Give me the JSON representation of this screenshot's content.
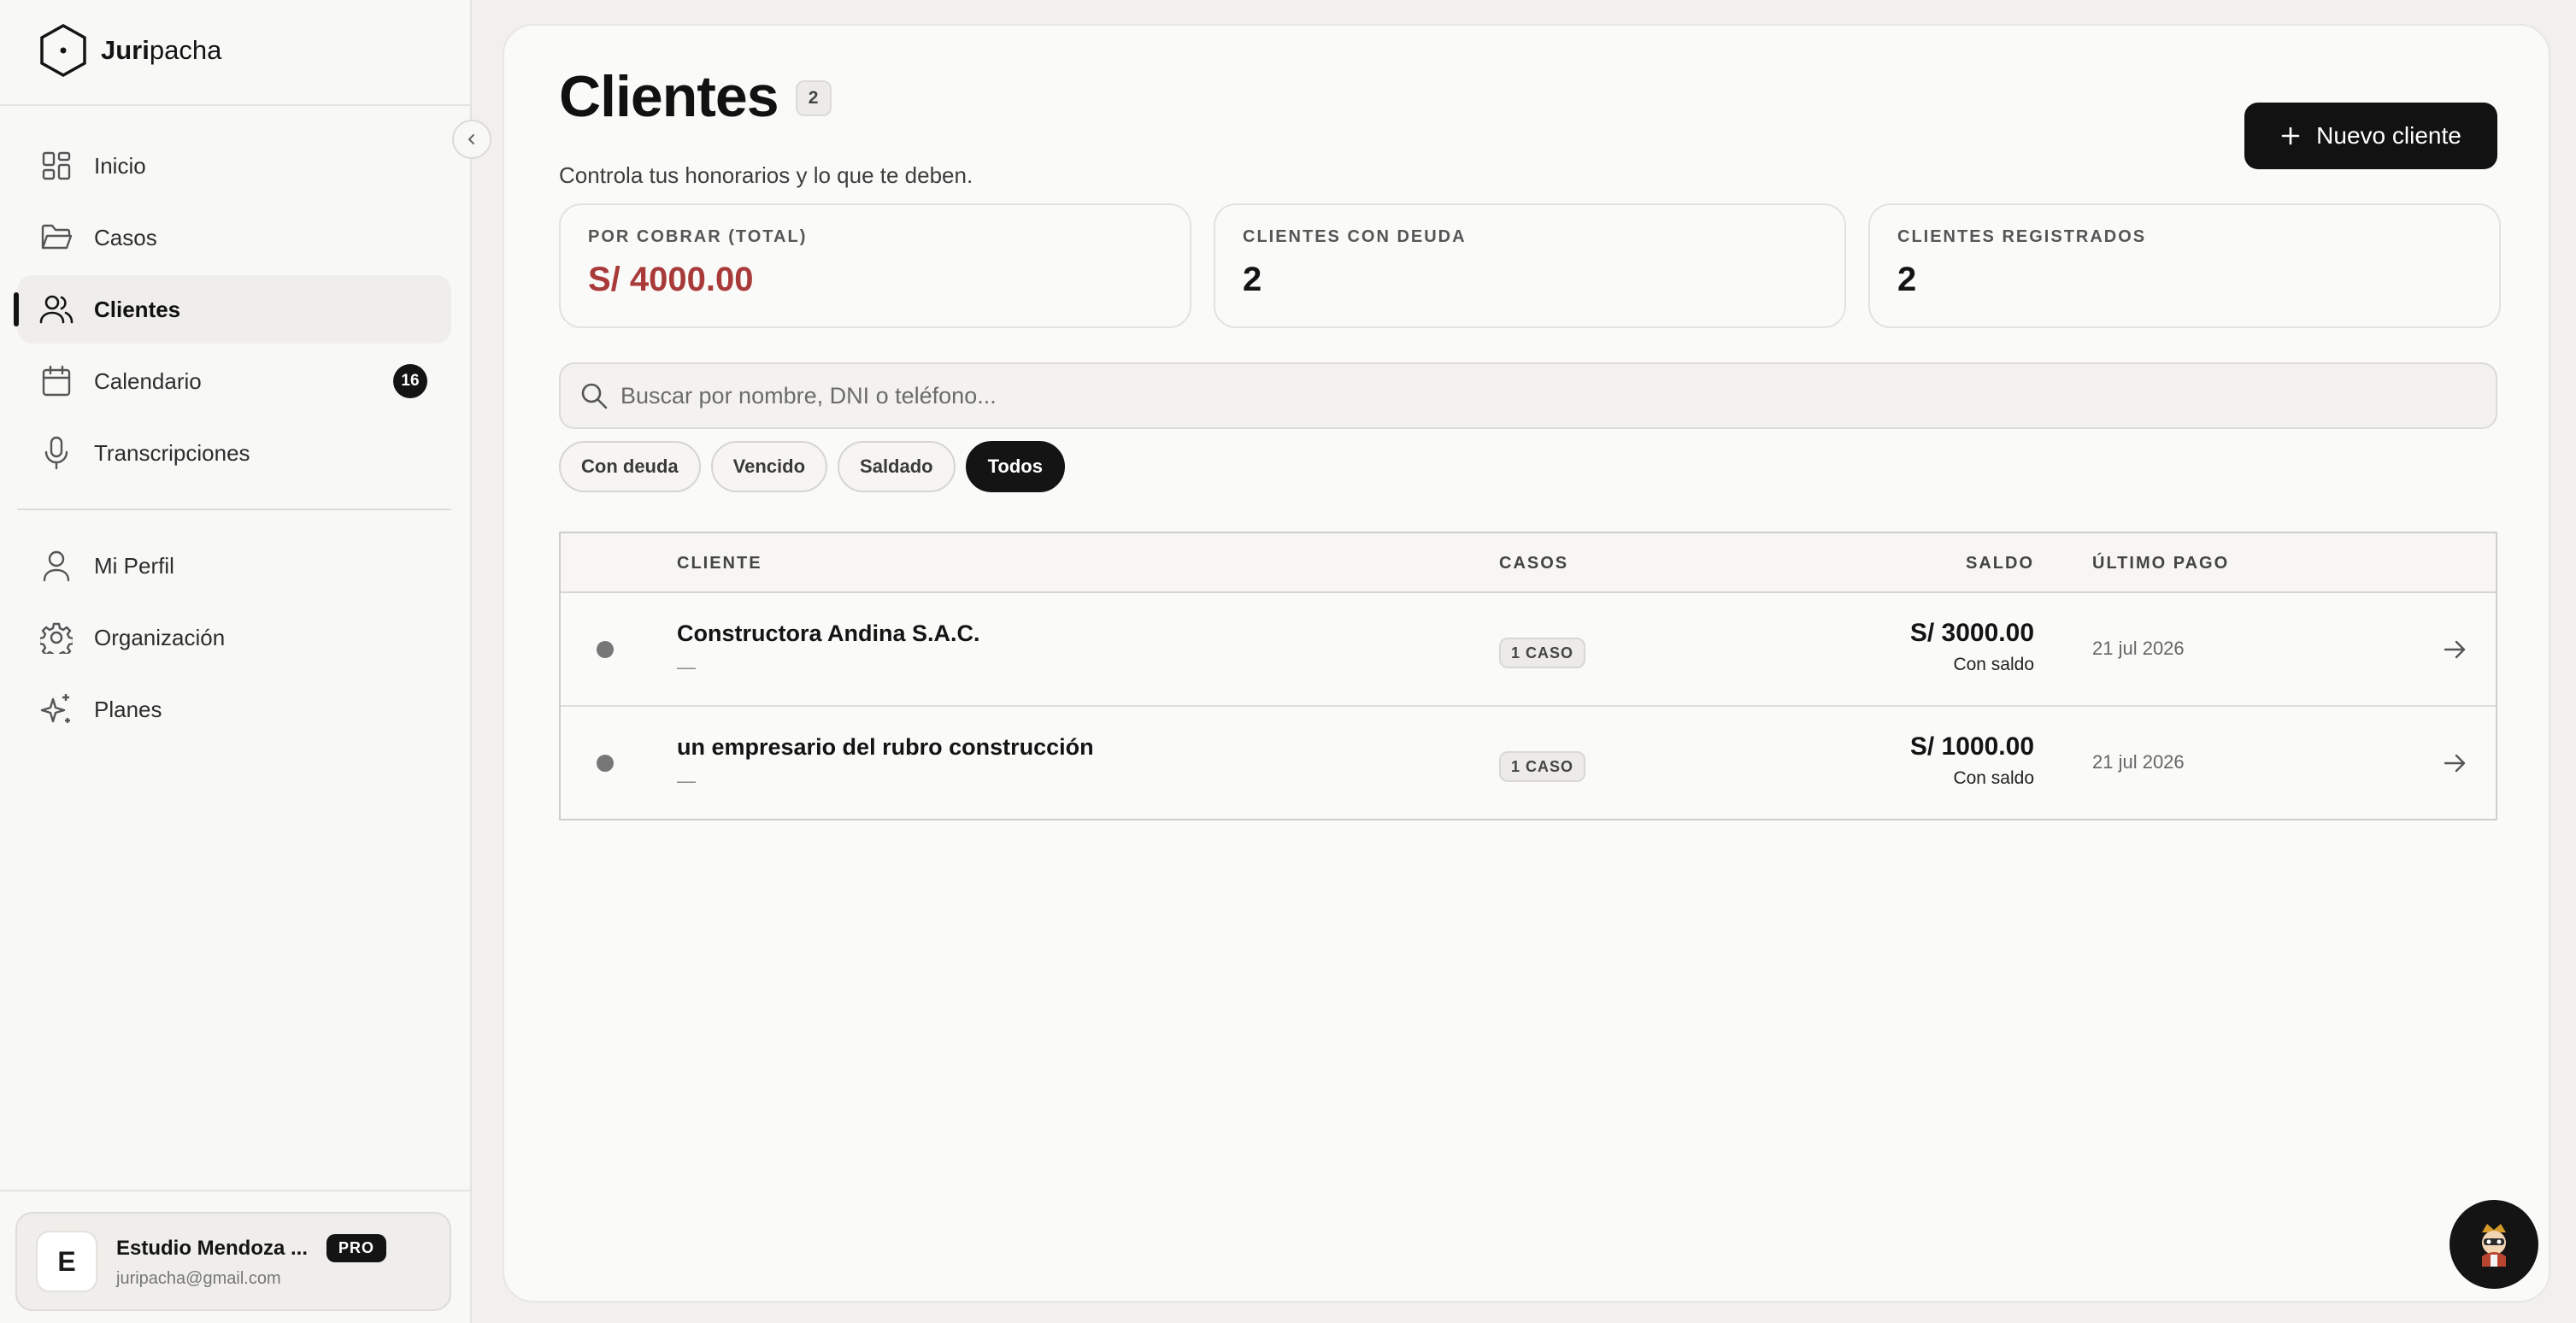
{
  "brand": {
    "bold": "Juri",
    "rest": "pacha"
  },
  "sidebar": {
    "items": [
      {
        "label": "Inicio",
        "icon": "dashboard-icon"
      },
      {
        "label": "Casos",
        "icon": "folder-icon"
      },
      {
        "label": "Clientes",
        "icon": "users-icon",
        "active": true
      },
      {
        "label": "Calendario",
        "icon": "calendar-icon",
        "badge": "16"
      },
      {
        "label": "Transcripciones",
        "icon": "microphone-icon"
      }
    ],
    "secondary": [
      {
        "label": "Mi Perfil",
        "icon": "user-icon"
      },
      {
        "label": "Organización",
        "icon": "gear-icon"
      },
      {
        "label": "Planes",
        "icon": "sparkles-icon"
      }
    ],
    "user": {
      "initial": "E",
      "name": "Estudio Mendoza ...",
      "plan": "PRO",
      "email": "juripacha@gmail.com"
    }
  },
  "main": {
    "title": "Clientes",
    "count": "2",
    "subtitle": "Controla tus honorarios y lo que te deben.",
    "new_button": "Nuevo cliente",
    "stats": [
      {
        "label": "POR COBRAR (TOTAL)",
        "value": "S/ 4000.00"
      },
      {
        "label": "CLIENTES CON DEUDA",
        "value": "2"
      },
      {
        "label": "CLIENTES REGISTRADOS",
        "value": "2"
      }
    ],
    "search_placeholder": "Buscar por nombre, DNI o teléfono...",
    "filters": [
      "Con deuda",
      "Vencido",
      "Saldado",
      "Todos"
    ],
    "active_filter": "Todos",
    "table": {
      "headers": {
        "client": "CLIENTE",
        "cases": "CASOS",
        "balance": "SALDO",
        "last_payment": "ÚLTIMO PAGO"
      },
      "rows": [
        {
          "name": "Constructora Andina S.A.C.",
          "sub": "—",
          "cases": "1 CASO",
          "balance": "S/ 3000.00",
          "status": "Con saldo",
          "last_payment": "21 jul 2026"
        },
        {
          "name": "un empresario del rubro construcción",
          "sub": "—",
          "cases": "1 CASO",
          "balance": "S/ 1000.00",
          "status": "Con saldo",
          "last_payment": "21 jul 2026"
        }
      ]
    }
  },
  "colors": {
    "accent": "#141414",
    "debt": "#a83a3a",
    "background": "#f1f0ec"
  }
}
